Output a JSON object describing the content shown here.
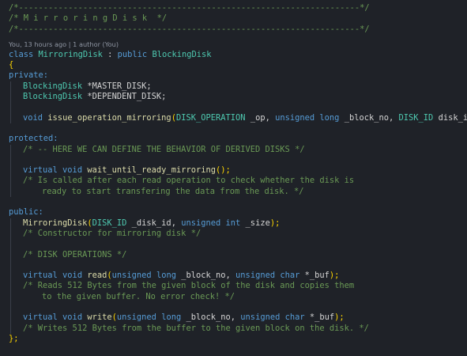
{
  "editor": {
    "codelens": "You, 13 hours ago | 1 author (You)",
    "header": {
      "rule1": "/*---------------------------------------------------------------------*/",
      "title": "/* M i r r o r i n g D i s k  */",
      "rule2": "/*---------------------------------------------------------------------*/"
    },
    "class_decl": {
      "kw_class": "class",
      "name": "MirroringDisk",
      "colon": " : ",
      "kw_public": "public",
      "base": "BlockingDisk"
    },
    "open_brace": "{",
    "close_brace": "};",
    "private_label": "private:",
    "members": [
      {
        "type": "BlockingDisk",
        "rest": " *MASTER_DISK;"
      },
      {
        "type": "BlockingDisk",
        "rest": " *DEPENDENT_DISK;"
      }
    ],
    "issue_op": {
      "kw_void": "void",
      "fn": "issue_operation_mirroring",
      "p1_type": "DISK_OPERATION",
      "p1_name": " _op, ",
      "p2_kw": "unsigned long",
      "p2_name": " _block_no, ",
      "p3_type": "DISK_ID",
      "p3_name": " disk_id",
      "end": ");"
    },
    "protected_label": "protected:",
    "protected_comment": "/* -- HERE WE CAN DEFINE THE BEHAVIOR OF DERIVED DISKS */",
    "wait_decl": {
      "kw": "virtual void",
      "fn": "wait_until_ready_mirroring",
      "end": "();"
    },
    "wait_comment_1": "/* Is called after each read operation to check whether the disk is",
    "wait_comment_2": "ready to start transfering the data from the disk. */",
    "public_label": "public:",
    "ctor_decl": {
      "fn": "MirroringDisk",
      "p1_type": "DISK_ID",
      "p1_name": " _disk_id, ",
      "p2_kw": "unsigned int",
      "p2_name": " _size",
      "end": ");"
    },
    "ctor_comment": "/* Constructor for mirroring disk */",
    "disk_ops_comment": "/* DISK OPERATIONS */",
    "read_decl": {
      "kw": "virtual void",
      "fn": "read",
      "p1_kw": "unsigned long",
      "p1_name": " _block_no, ",
      "p2_kw": "unsigned char",
      "p2_name": " *_buf",
      "end": ");"
    },
    "read_comment_1": "/* Reads 512 Bytes from the given block of the disk and copies them",
    "read_comment_2": "to the given buffer. No error check! */",
    "write_decl": {
      "kw": "virtual void",
      "fn": "write",
      "p1_kw": "unsigned long",
      "p1_name": " _block_no, ",
      "p2_kw": "unsigned char",
      "p2_name": " *_buf",
      "end": ");"
    },
    "write_comment": "/* Writes 512 Bytes from the buffer to the given block on the disk. */"
  }
}
